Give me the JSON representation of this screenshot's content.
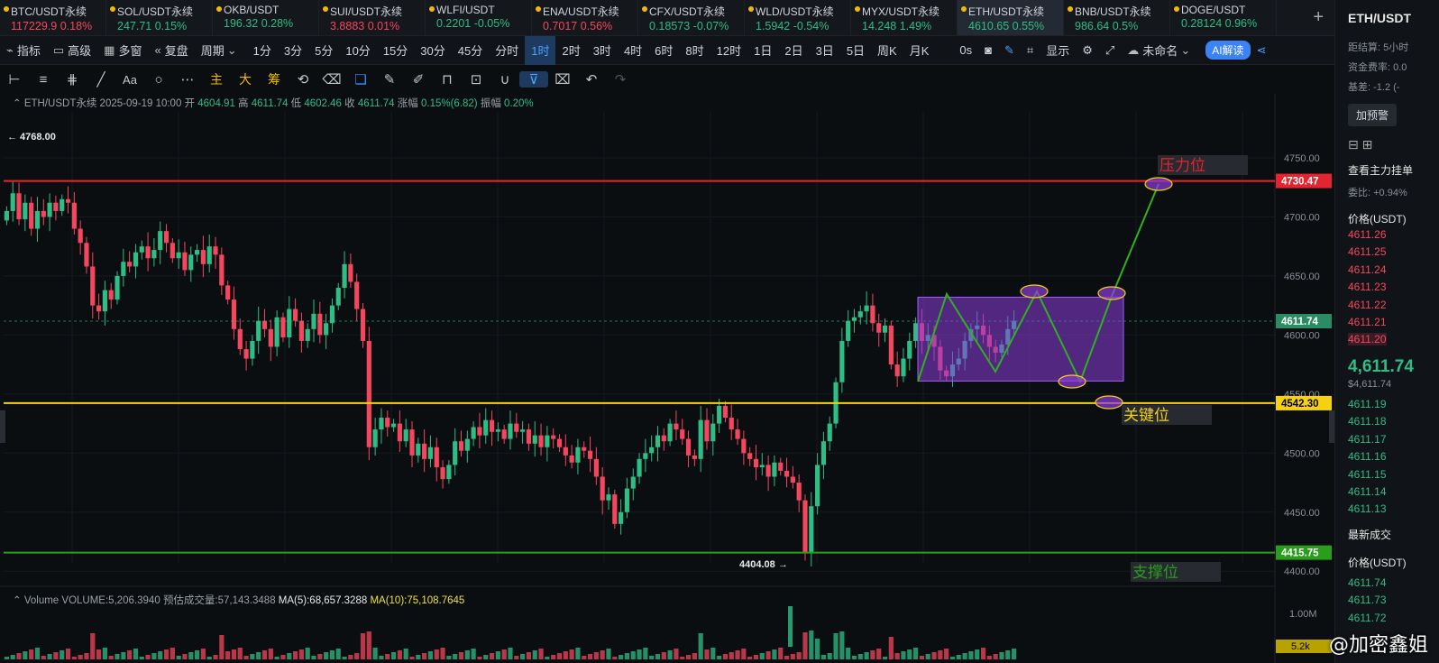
{
  "tickers": [
    {
      "symbol": "BTC/USDT永续",
      "price": "117229.9",
      "change": "0.18%",
      "dir": "dn"
    },
    {
      "symbol": "SOL/USDT永续",
      "price": "247.71",
      "change": "0.15%",
      "dir": "up"
    },
    {
      "symbol": "OKB/USDT",
      "price": "196.32",
      "change": "0.28%",
      "dir": "up"
    },
    {
      "symbol": "SUI/USDT永续",
      "price": "3.8883",
      "change": "0.01%",
      "dir": "dn"
    },
    {
      "symbol": "WLFI/USDT",
      "price": "0.2201",
      "change": "-0.05%",
      "dir": "up"
    },
    {
      "symbol": "ENA/USDT永续",
      "price": "0.7017",
      "change": "0.56%",
      "dir": "dn"
    },
    {
      "symbol": "CFX/USDT永续",
      "price": "0.18573",
      "change": "-0.07%",
      "dir": "up"
    },
    {
      "symbol": "WLD/USDT永续",
      "price": "1.5942",
      "change": "-0.54%",
      "dir": "up"
    },
    {
      "symbol": "MYX/USDT永续",
      "price": "14.248",
      "change": "1.49%",
      "dir": "up"
    },
    {
      "symbol": "ETH/USDT永续",
      "price": "4610.65",
      "change": "0.55%",
      "dir": "up",
      "active": true
    },
    {
      "symbol": "BNB/USDT永续",
      "price": "986.64",
      "change": "0.5%",
      "dir": "up"
    },
    {
      "symbol": "DOGE/USDT",
      "price": "0.28124",
      "change": "0.96%",
      "dir": "up"
    }
  ],
  "toolbar": {
    "indicators": "指标",
    "advanced": "高级",
    "multi": "多窗",
    "replay": "复盘",
    "period": "周期",
    "intervals": [
      "1分",
      "3分",
      "5分",
      "10分",
      "15分",
      "30分",
      "45分",
      "分时",
      "1时",
      "2时",
      "3时",
      "4时",
      "6时",
      "8时",
      "12时",
      "1日",
      "2日",
      "3日",
      "5日",
      "周K",
      "月K"
    ],
    "selected_interval": "1时",
    "countdown": "0s",
    "display": "显示",
    "unnamed": "未命名",
    "ai": "AI解读"
  },
  "drawbar": {
    "labels": [
      "Aa",
      "主",
      "大",
      "筹"
    ]
  },
  "info": {
    "symbol": "ETH/USDT永续",
    "time": "2025-09-19 10:00",
    "open_label": "开",
    "open": "4604.91",
    "high_label": "高",
    "high": "4611.74",
    "low_label": "低",
    "low": "4602.46",
    "close_label": "收",
    "close": "4611.74",
    "chg_label": "涨幅",
    "chg": "0.15%(6.82)",
    "amp_label": "振幅",
    "amp": "0.20%"
  },
  "volume_info": {
    "label": "Volume",
    "volume": "VOLUME:5,206.3940",
    "est": "预估成交量:57,143.3488",
    "ma5": "MA(5):68,657.3288",
    "ma10": "MA(10):75,108.7645"
  },
  "chart_data": {
    "type": "candlestick",
    "y_ticks": [
      4750,
      4700,
      4650,
      4600,
      4550,
      4500,
      4450,
      4400
    ],
    "y_tick_labels": [
      "4750.00",
      "4700.00",
      "4650.00",
      "4600.00",
      "4550.00",
      "4500.00",
      "4450.00",
      "4400.00"
    ],
    "ylim": [
      4390,
      4760
    ],
    "high_marker": "← 4768.00",
    "low_marker": "4404.08 →",
    "current_price": {
      "value": 4611.74,
      "label": "4611.74"
    },
    "levels": [
      {
        "value": 4730.47,
        "label": "4730.47",
        "text": "压力位",
        "color": "#e5242f"
      },
      {
        "value": 4542.3,
        "label": "4542.30",
        "text": "关键位",
        "color": "#f5d20c"
      },
      {
        "value": 4415.75,
        "label": "4415.75",
        "text": "支撑位",
        "color": "#2a9d1c"
      }
    ],
    "vol_tick_labels": [
      "1.00M",
      "5.2k"
    ],
    "closes": [
      4705,
      4720,
      4698,
      4712,
      4690,
      4705,
      4700,
      4712,
      4705,
      4715,
      4712,
      4690,
      4678,
      4658,
      4625,
      4620,
      4638,
      4630,
      4650,
      4662,
      4658,
      4670,
      4675,
      4665,
      4672,
      4688,
      4678,
      4665,
      4670,
      4655,
      4668,
      4672,
      4660,
      4675,
      4668,
      4642,
      4630,
      4605,
      4588,
      4580,
      4595,
      4612,
      4605,
      4590,
      4615,
      4598,
      4622,
      4612,
      4595,
      4605,
      4618,
      4600,
      4610,
      4625,
      4640,
      4660,
      4645,
      4622,
      4595,
      4505,
      4520,
      4530,
      4522,
      4525,
      4510,
      4520,
      4498,
      4508,
      4495,
      4505,
      4488,
      4478,
      4490,
      4510,
      4502,
      4512,
      4522,
      4515,
      4528,
      4518,
      4520,
      4512,
      4525,
      4518,
      4520,
      4508,
      4515,
      4505,
      4515,
      4512,
      4505,
      4498,
      4492,
      4505,
      4502,
      4495,
      4480,
      4460,
      4465,
      4440,
      4450,
      4470,
      4480,
      4495,
      4500,
      4505,
      4515,
      4510,
      4525,
      4520,
      4512,
      4498,
      4495,
      4528,
      4510,
      4525,
      4540,
      4530,
      4520,
      4512,
      4500,
      4495,
      4488,
      4490,
      4480,
      4492,
      4485,
      4480,
      4475,
      4460,
      4415,
      4455,
      4490,
      4510,
      4525,
      4560,
      4595,
      4612,
      4615,
      4620,
      4625,
      4610,
      4602,
      4608,
      4575,
      4565,
      4580,
      4595,
      4610,
      4595,
      4600,
      4590,
      4570,
      4565,
      4575,
      4580,
      4595,
      4605,
      4608,
      4600,
      4590,
      4585,
      4592,
      4605,
      4612
    ]
  },
  "annotations": {
    "box": {
      "top": 4632,
      "bottom": 4561
    }
  },
  "panel": {
    "title": "ETH/USDT",
    "rows": [
      "距结算: 5小时",
      "资金费率: 0.0",
      "基差: -1.2 (-"
    ],
    "alert_btn": "加预警",
    "section": "查看主力挂单",
    "ratio": "委比: +0.94%",
    "price_header": "价格(USDT)",
    "asks": [
      "4611.26",
      "4611.25",
      "4611.24",
      "4611.23",
      "4611.22",
      "4611.21",
      "4611.20"
    ],
    "last_price": "4,611.74",
    "last_usd": "$4,611.74",
    "bids": [
      "4611.19",
      "4611.18",
      "4611.17",
      "4611.16",
      "4611.15",
      "4611.14",
      "4611.13"
    ],
    "trades_header": "最新成交",
    "trades_price_header": "价格(USDT)",
    "trades": [
      "4611.74",
      "4611.73",
      "4611.72"
    ]
  },
  "watermark": "@加密鑫姐"
}
